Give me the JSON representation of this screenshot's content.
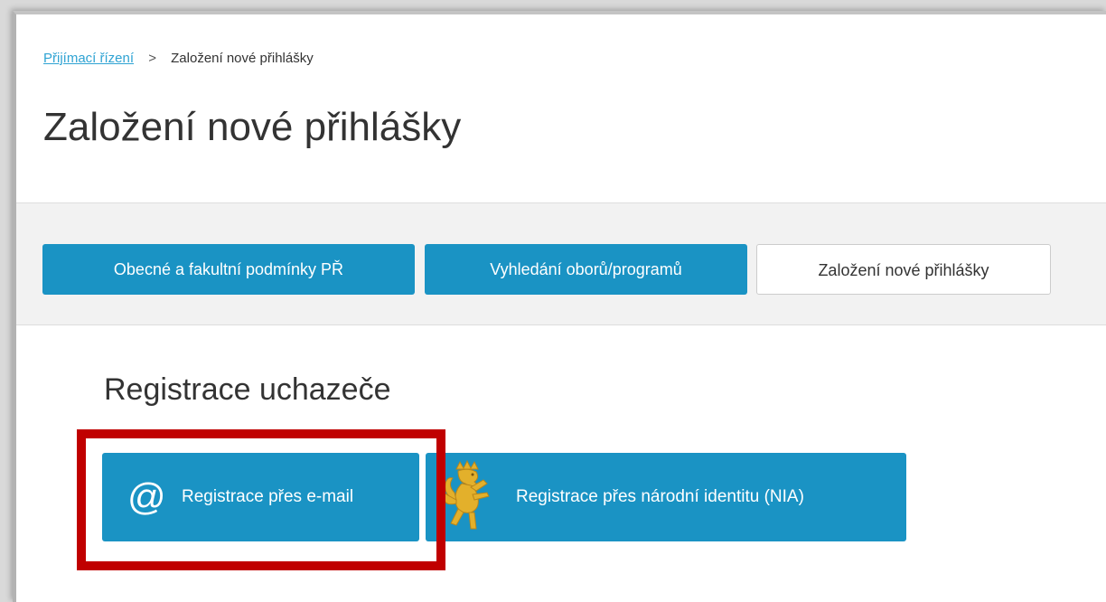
{
  "breadcrumb": {
    "link": "Přijímací řízení",
    "separator": ">",
    "current": "Založení nové přihlášky"
  },
  "page_title": "Založení nové přihlášky",
  "nav": {
    "buttons": [
      {
        "label": "Obecné a fakultní podmínky PŘ"
      },
      {
        "label": "Vyhledání oborů/programů"
      },
      {
        "label": "Založení nové přihlášky"
      }
    ]
  },
  "registration": {
    "title": "Registrace uchazeče",
    "email_label": "Registrace přes e-mail",
    "email_icon": "@",
    "nia_label": "Registrace přes národní identitu (NIA)"
  },
  "colors": {
    "accent": "#1a93c4",
    "link": "#2fa3d3",
    "highlight": "#c00000",
    "lion": "#e3b02b"
  },
  "icons": {
    "email": "at-icon",
    "nia": "czech-lion-icon"
  }
}
